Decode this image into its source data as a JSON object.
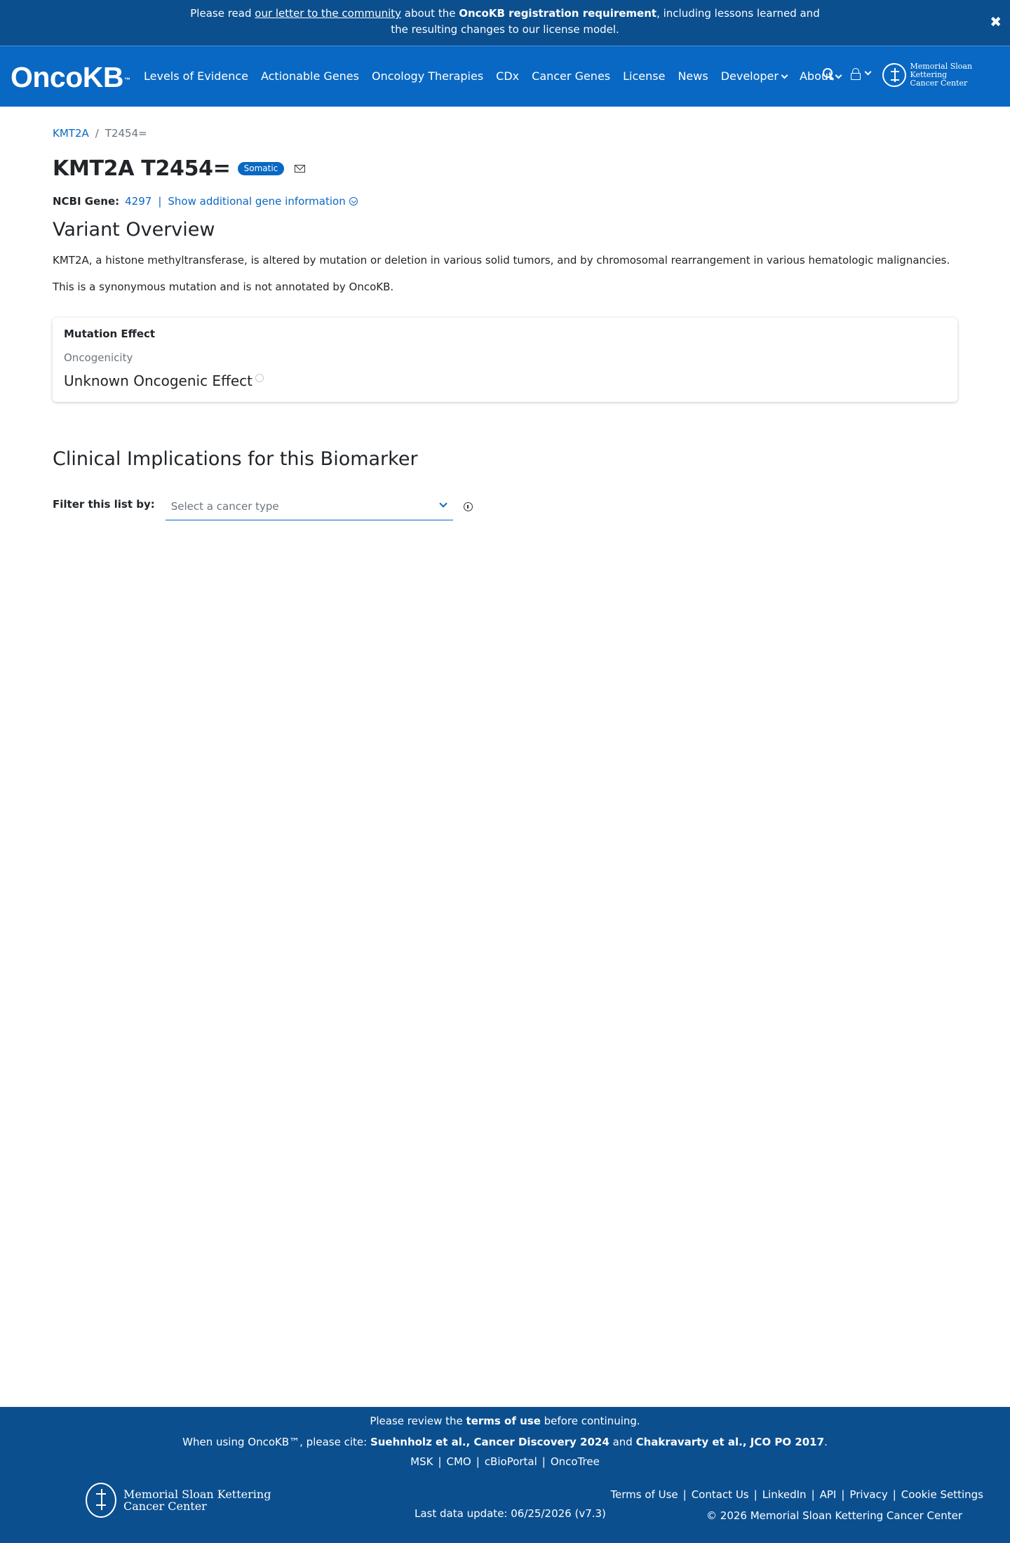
{
  "banner": {
    "pre": "Please read ",
    "link": "our letter to the community",
    "mid": " about the ",
    "bold": "OncoKB registration requirement",
    "post": ", including lessons learned and",
    "line2": "the resulting changes to our license model.",
    "close": "✖"
  },
  "nav": {
    "logo": "OncoKB",
    "logo_tm": "™",
    "items": [
      "Levels of Evidence",
      "Actionable Genes",
      "Oncology Therapies",
      "CDx",
      "Cancer Genes",
      "License",
      "News",
      "Developer",
      "About"
    ],
    "msk_line1": "Memorial Sloan Kettering",
    "msk_line2": "Cancer Center"
  },
  "breadcrumb": {
    "gene": "KMT2A",
    "sep": "/",
    "variant": "T2454="
  },
  "header": {
    "title": "KMT2A T2454=",
    "badge": "Somatic"
  },
  "gene_info": {
    "label": "NCBI Gene:",
    "id": "4297",
    "pipe": "|",
    "more": "Show additional gene information"
  },
  "overview": {
    "heading": "Variant Overview",
    "summary": "KMT2A, a histone methyltransferase, is altered by mutation or deletion in various solid tumors, and by chromosomal rearrangement in various hematologic malignancies.",
    "note": "This is a synonymous mutation and is not annotated by OncoKB."
  },
  "mutation_effect": {
    "title": "Mutation Effect",
    "subtitle": "Oncogenicity",
    "value": "Unknown Oncogenic Effect"
  },
  "clinical": {
    "heading": "Clinical Implications for this Biomarker",
    "filter_label": "Filter this list by:",
    "select_placeholder": "Select a cancer type"
  },
  "footer": {
    "review_pre": "Please review the ",
    "review_bold": "terms of use",
    "review_post": " before continuing.",
    "cite_pre": "When using OncoKB™, please cite: ",
    "cite_b1": "Suehnholz et al., Cancer Discovery 2024",
    "cite_and": " and ",
    "cite_b2": "Chakravarty et al., JCO PO 2017",
    "cite_end": ".",
    "links": [
      "MSK",
      "CMO",
      "cBioPortal",
      "OncoTree"
    ],
    "right_links": [
      "Terms of Use",
      "Contact Us",
      "LinkedIn",
      "API",
      "Privacy",
      "Cookie Settings"
    ],
    "sep": "|",
    "update": "Last data update: 06/25/2026 (v7.3)",
    "copyright": "© 2026 Memorial Sloan Kettering Cancer Center",
    "msk_line1": "Memorial Sloan Kettering",
    "msk_line2": "Cancer Center"
  }
}
